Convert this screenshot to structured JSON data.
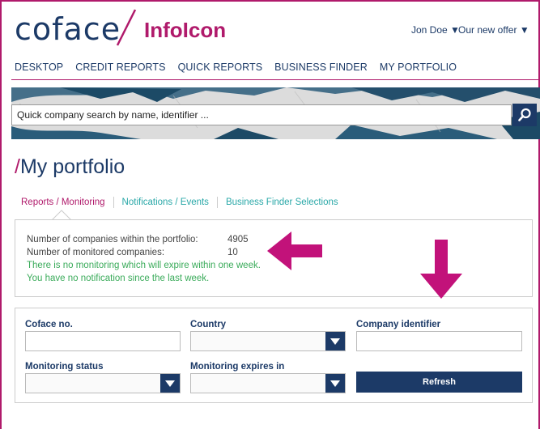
{
  "header": {
    "brand": "coface",
    "product": "InfoIcon",
    "user_menu": "Jon Doe ▼",
    "offer_menu": "Our new offer ▼"
  },
  "nav": {
    "items": [
      "DESKTOP",
      "CREDIT REPORTS",
      "QUICK REPORTS",
      "BUSINESS FINDER",
      "MY PORTFOLIO"
    ]
  },
  "search": {
    "placeholder": "Quick company search by name, identifier ..."
  },
  "page": {
    "title": "My portfolio",
    "title_prefix": "/"
  },
  "tabs": {
    "items": [
      "Reports / Monitoring",
      "Notifications / Events",
      "Business Finder Selections"
    ],
    "active": "Reports / Monitoring"
  },
  "summary": {
    "companies_label": "Number of companies within the portfolio:",
    "companies_value": "4905",
    "monitored_label": "Number of monitored companies:",
    "monitored_value": "10",
    "monitoring_notice": "There is no monitoring which will expire within one week.",
    "notification_notice": "You have no notification since the last week."
  },
  "filters": {
    "coface_no_label": "Coface no.",
    "country_label": "Country",
    "company_identifier_label": "Company identifier",
    "monitoring_status_label": "Monitoring status",
    "monitoring_expires_label": "Monitoring expires in",
    "refresh_label": "Refresh"
  },
  "colors": {
    "brand_navy": "#1c3a67",
    "brand_magenta": "#b01a6b",
    "teal_link": "#2aa8a8",
    "notice_green": "#3aab5a",
    "annotation_arrow": "#c2127a"
  },
  "icons": {
    "search": "magnifier-icon",
    "dropdown": "caret-down-icon"
  }
}
